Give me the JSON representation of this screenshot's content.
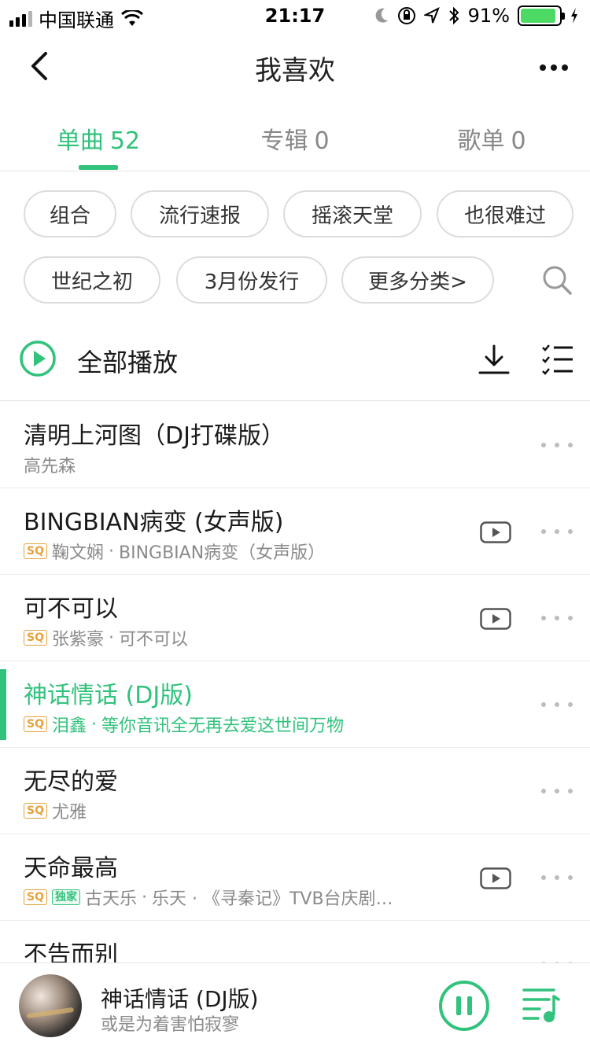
{
  "status_bar": {
    "carrier": "中国联通",
    "time": "21:17",
    "battery_percent": "91%",
    "battery_level": 0.91,
    "icons": [
      "signal-icon",
      "wifi-icon",
      "moon-icon",
      "rotation-lock-icon",
      "location-icon",
      "bluetooth-icon",
      "battery-icon",
      "charging-icon"
    ]
  },
  "nav": {
    "title": "我喜欢",
    "back_icon": "chevron-left-icon",
    "more_icon": "more-dots-icon"
  },
  "tabs": [
    {
      "label": "单曲",
      "count": "52",
      "active": true
    },
    {
      "label": "专辑",
      "count": "0",
      "active": false
    },
    {
      "label": "歌单",
      "count": "0",
      "active": false
    }
  ],
  "filters": {
    "chips": [
      "组合",
      "流行速报",
      "摇滚天堂",
      "也很难过",
      "世纪之初",
      "3月份发行",
      "更多分类>"
    ],
    "search_icon": "search-icon"
  },
  "play_all": {
    "label": "全部播放",
    "download_icon": "download-icon",
    "multi_select_icon": "multi-select-icon"
  },
  "songs": [
    {
      "title": "清明上河图（DJ打碟版）",
      "artist": "高先森",
      "album": "",
      "sq": false,
      "exclusive": false,
      "mv": false,
      "playing": false
    },
    {
      "title": "BINGBIAN病变 (女声版)",
      "artist": "鞠文娴",
      "album": "BINGBIAN病变（女声版）",
      "sq": true,
      "exclusive": false,
      "mv": true,
      "playing": false
    },
    {
      "title": "可不可以",
      "artist": "张紫豪",
      "album": "可不可以",
      "sq": true,
      "exclusive": false,
      "mv": true,
      "playing": false
    },
    {
      "title": "神话情话 (DJ版)",
      "artist": "泪鑫",
      "album": "等你音讯全无再去爱这世间万物",
      "sq": true,
      "exclusive": false,
      "mv": false,
      "playing": true
    },
    {
      "title": "无尽的爱",
      "artist": "尤雅",
      "album": "",
      "sq": true,
      "exclusive": false,
      "mv": false,
      "playing": false
    },
    {
      "title": "天命最高",
      "artist": "古天乐",
      "album": "乐天 · 《寻秦记》TVB台庆剧…",
      "sq": true,
      "exclusive": true,
      "mv": true,
      "playing": false
    },
    {
      "title": "不告而别",
      "artist": "",
      "album": "",
      "sq": false,
      "exclusive": false,
      "mv": false,
      "playing": false
    }
  ],
  "badges": {
    "sq": "SQ",
    "exclusive": "独家"
  },
  "separator": " · ",
  "player": {
    "title": "神话情话 (DJ版)",
    "subtitle": "或是为着害怕寂寥",
    "pause_icon": "pause-icon",
    "playlist_icon": "playlist-icon"
  },
  "colors": {
    "accent": "#31c27c",
    "sq_badge": "#e6a23c",
    "text_primary": "#1a1a1a",
    "text_secondary": "#8a8a8a"
  }
}
